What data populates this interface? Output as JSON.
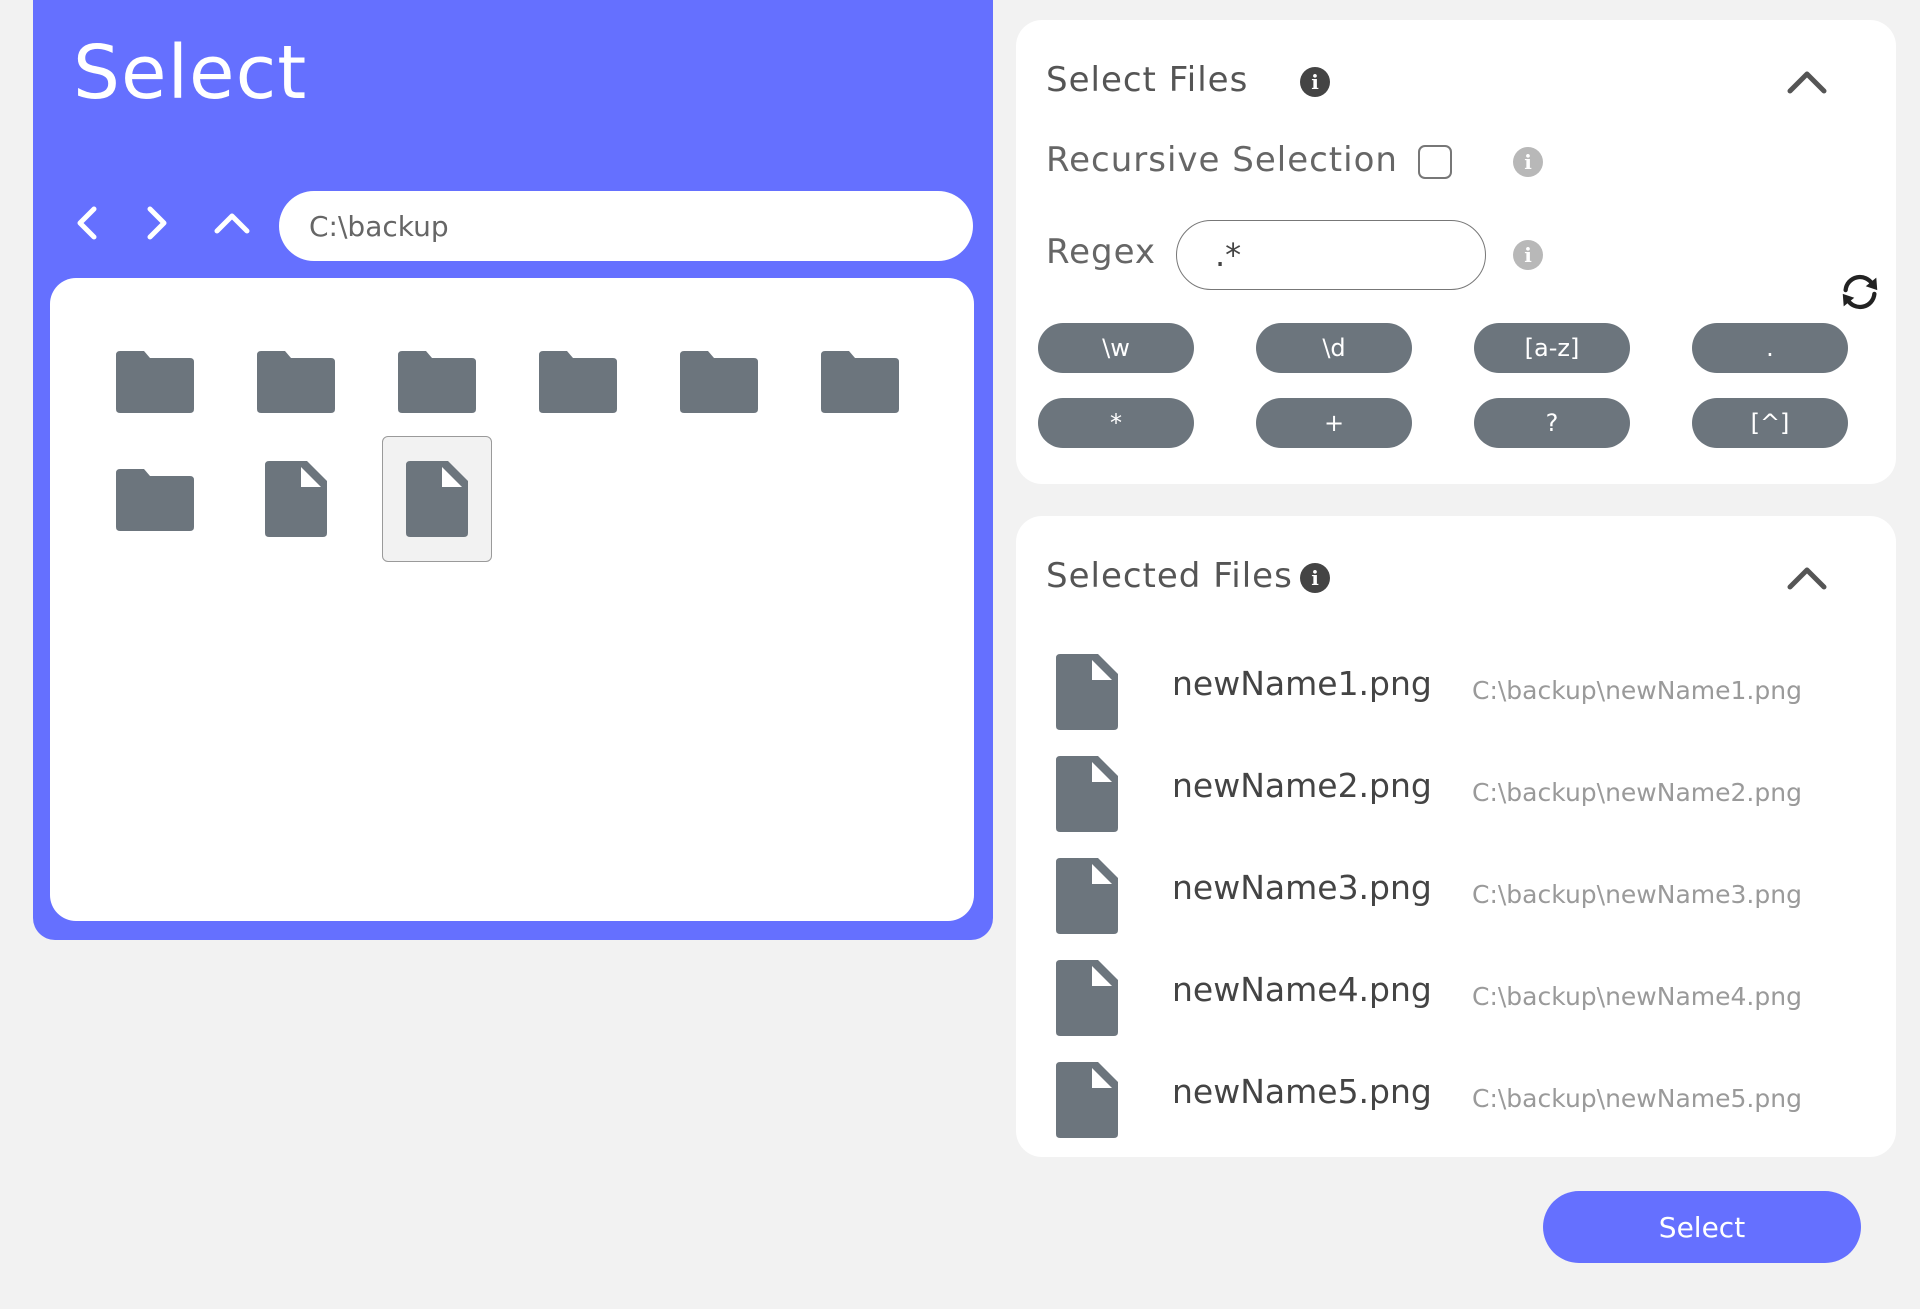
{
  "browser": {
    "title": "Select",
    "path": "C:\\backup",
    "items": [
      {
        "type": "folder",
        "selected": false
      },
      {
        "type": "folder",
        "selected": false
      },
      {
        "type": "folder",
        "selected": false
      },
      {
        "type": "folder",
        "selected": false
      },
      {
        "type": "folder",
        "selected": false
      },
      {
        "type": "folder",
        "selected": false
      },
      {
        "type": "folder",
        "selected": false
      },
      {
        "type": "file",
        "selected": false
      },
      {
        "type": "file",
        "selected": true
      }
    ]
  },
  "select_files": {
    "title": "Select Files",
    "recursive_label": "Recursive Selection",
    "recursive_checked": false,
    "regex_label": "Regex",
    "regex_value": ".*",
    "chips": [
      "\\w",
      "\\d",
      "[a-z]",
      ".",
      "*",
      "+",
      "?",
      "[^]"
    ]
  },
  "selected_files": {
    "title": "Selected Files",
    "files": [
      {
        "name": "newName1.png",
        "path": "C:\\backup\\newName1.png"
      },
      {
        "name": "newName2.png",
        "path": "C:\\backup\\newName2.png"
      },
      {
        "name": "newName3.png",
        "path": "C:\\backup\\newName3.png"
      },
      {
        "name": "newName4.png",
        "path": "C:\\backup\\newName4.png"
      },
      {
        "name": "newName5.png",
        "path": "C:\\backup\\newName5.png"
      }
    ]
  },
  "actions": {
    "select_label": "Select"
  },
  "colors": {
    "accent": "#6570ff",
    "icon_gray": "#6c757d",
    "background": "#f2f2f2"
  }
}
